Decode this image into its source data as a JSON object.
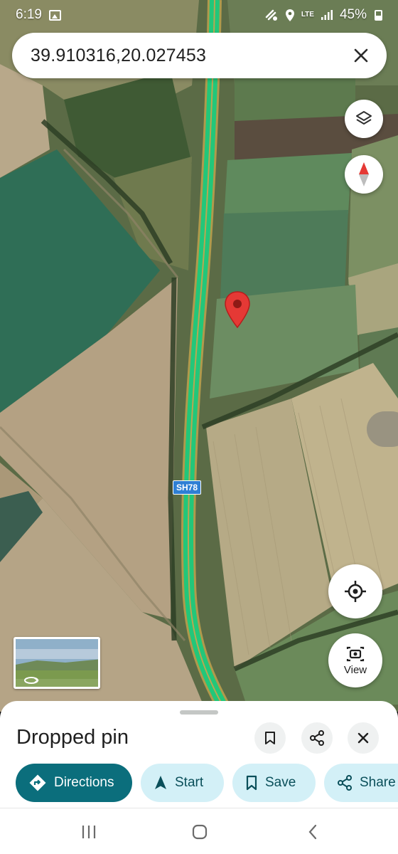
{
  "status_bar": {
    "time": "6:19",
    "network": "LTE",
    "battery": "45%"
  },
  "search": {
    "value": "39.910316,20.027453"
  },
  "map": {
    "road_label": "SH78",
    "pin_color": "#e53935",
    "route_color": "#22c77a"
  },
  "map_controls": {
    "view_label": "View"
  },
  "sheet": {
    "title": "Dropped pin",
    "actions": {
      "directions": "Directions",
      "start": "Start",
      "save": "Save",
      "share": "Share"
    }
  },
  "icons": {
    "layers": "layers-icon",
    "compass": "compass-icon",
    "locate": "my-location-icon",
    "view": "street-view-icon",
    "bookmark": "bookmark-icon",
    "share": "share-icon",
    "close": "close-icon"
  },
  "colors": {
    "primary_chip": "#0b6e7c",
    "secondary_chip": "#d3f0f7"
  }
}
